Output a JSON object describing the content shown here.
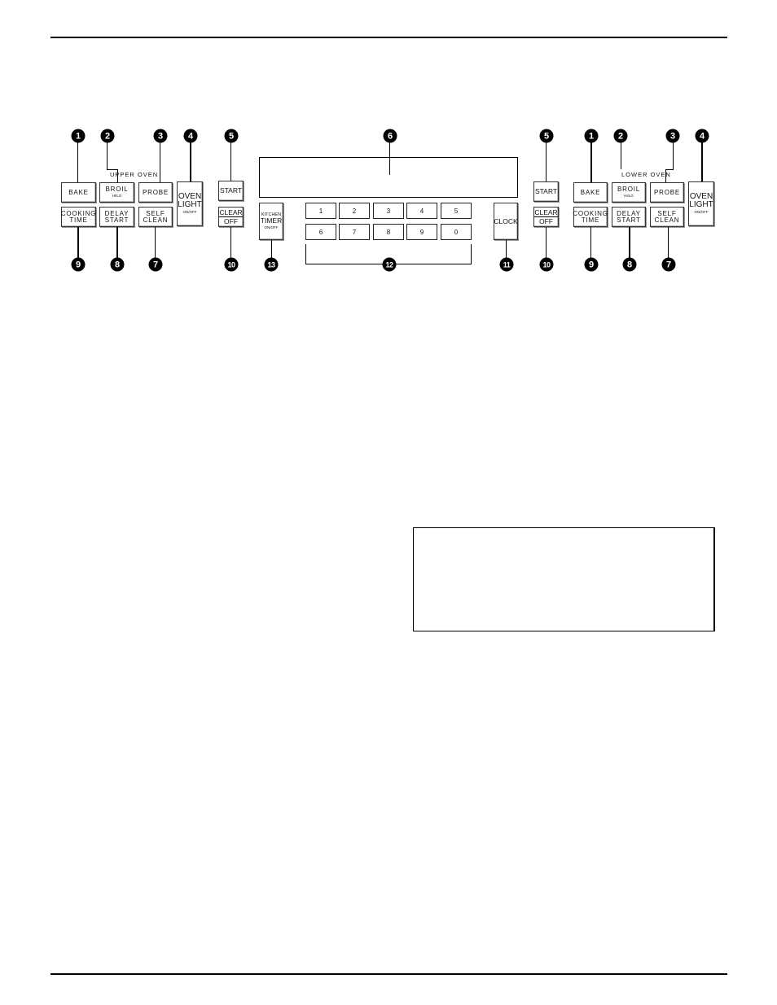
{
  "upper_oven": {
    "label": "UPPER OVEN",
    "bake": "BAKE",
    "broil": "BROIL",
    "broil_sub": "HI/LO",
    "probe": "PROBE",
    "oven_light_1": "OVEN",
    "oven_light_2": "LIGHT",
    "oven_light_sub": "ON/OFF",
    "cooking_time_1": "COOKING",
    "cooking_time_2": "TIME",
    "delay_start_1": "DELAY",
    "delay_start_2": "START",
    "self_clean_1": "SELF",
    "self_clean_2": "CLEAN",
    "start": "START",
    "clear": "CLEAR",
    "off": "OFF"
  },
  "lower_oven": {
    "label": "LOWER OVEN",
    "bake": "BAKE",
    "broil": "BROIL",
    "broil_sub": "HI/LO",
    "probe": "PROBE",
    "oven_light_1": "OVEN",
    "oven_light_2": "LIGHT",
    "oven_light_sub": "ON/OFF",
    "cooking_time_1": "COOKING",
    "cooking_time_2": "TIME",
    "delay_start_1": "DELAY",
    "delay_start_2": "START",
    "self_clean_1": "SELF",
    "self_clean_2": "CLEAN",
    "start": "START",
    "clear": "CLEAR",
    "off": "OFF"
  },
  "center": {
    "kitchen_timer_1": "KITCHEN",
    "kitchen_timer_2": "TIMER",
    "kitchen_timer_sub": "ON/OFF",
    "clock": "CLOCK",
    "keys": [
      "1",
      "2",
      "3",
      "4",
      "5",
      "6",
      "7",
      "8",
      "9",
      "0"
    ]
  },
  "callouts": {
    "c1": "1",
    "c2": "2",
    "c3": "3",
    "c4": "4",
    "c5": "5",
    "c6": "6",
    "c7": "7",
    "c8": "8",
    "c9": "9",
    "c10": "10",
    "c11": "11",
    "c12": "12",
    "c13": "13"
  }
}
